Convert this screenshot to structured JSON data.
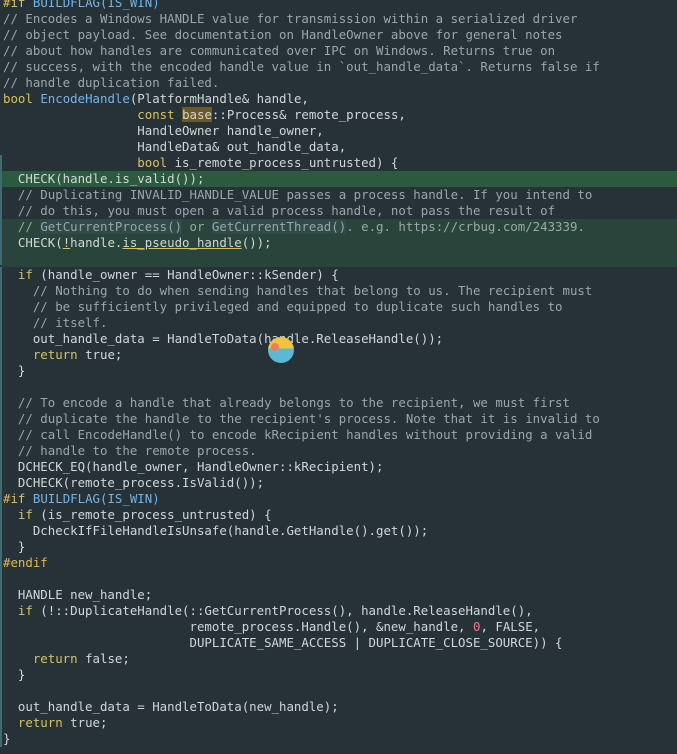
{
  "lines": [
    "#if BUILDFLAG(IS_WIN)",
    "// Encodes a Windows HANDLE value for transmission within a serialized driver",
    "// object payload. See documentation on HandleOwner above for general notes",
    "// about how handles are communicated over IPC on Windows. Returns true on",
    "// success, with the encoded handle value in `out_handle_data`. Returns false if",
    "// handle duplication failed.",
    "bool EncodeHandle(PlatformHandle& handle,",
    "                  const base::Process& remote_process,",
    "                  HandleOwner handle_owner,",
    "                  HandleData& out_handle_data,",
    "                  bool is_remote_process_untrusted) {",
    "  CHECK(handle.is_valid());",
    "  // Duplicating INVALID_HANDLE_VALUE passes a process handle. If you intend to",
    "  // do this, you must open a valid process handle, not pass the result of",
    "  // GetCurrentProcess() or GetCurrentThread(). e.g. https://crbug.com/243339.",
    "  CHECK(!handle.is_pseudo_handle());",
    "",
    "  if (handle_owner == HandleOwner::kSender) {",
    "    // Nothing to do when sending handles that belong to us. The recipient must",
    "    // be sufficiently privileged and equipped to duplicate such handles to",
    "    // itself.",
    "    out_handle_data = HandleToData(handle.ReleaseHandle());",
    "    return true;",
    "  }",
    "",
    "  // To encode a handle that already belongs to the recipient, we must first",
    "  // duplicate the handle to the recipient's process. Note that it is invalid to",
    "  // call EncodeHandle() to encode kRecipient handles without providing a valid",
    "  // handle to the remote process.",
    "  DCHECK_EQ(handle_owner, HandleOwner::kRecipient);",
    "  DCHECK(remote_process.IsValid());",
    "#if BUILDFLAG(IS_WIN)",
    "  if (is_remote_process_untrusted) {",
    "    DcheckIfFileHandleIsUnsafe(handle.GetHandle().get());",
    "  }",
    "#endif",
    "",
    "  HANDLE new_handle;",
    "  if (!::DuplicateHandle(::GetCurrentProcess(), handle.ReleaseHandle(),",
    "                         remote_process.Handle(), &new_handle, 0, FALSE,",
    "                         DUPLICATE_SAME_ACCESS | DUPLICATE_CLOSE_SOURCE)) {",
    "    return false;",
    "  }",
    "",
    "  out_handle_data = HandleToData(new_handle);",
    "  return true;",
    "}"
  ],
  "colors": {
    "background": "#263238",
    "text": "#d2d6d9",
    "comment": "#9aa6ab",
    "keyword": "#d9c25c",
    "type": "#73b4e6",
    "preprocessor": "#e3b84a",
    "number": "#f07a8a",
    "highlight_line": "#2c5a3e",
    "highlight_block": "#29443a"
  }
}
